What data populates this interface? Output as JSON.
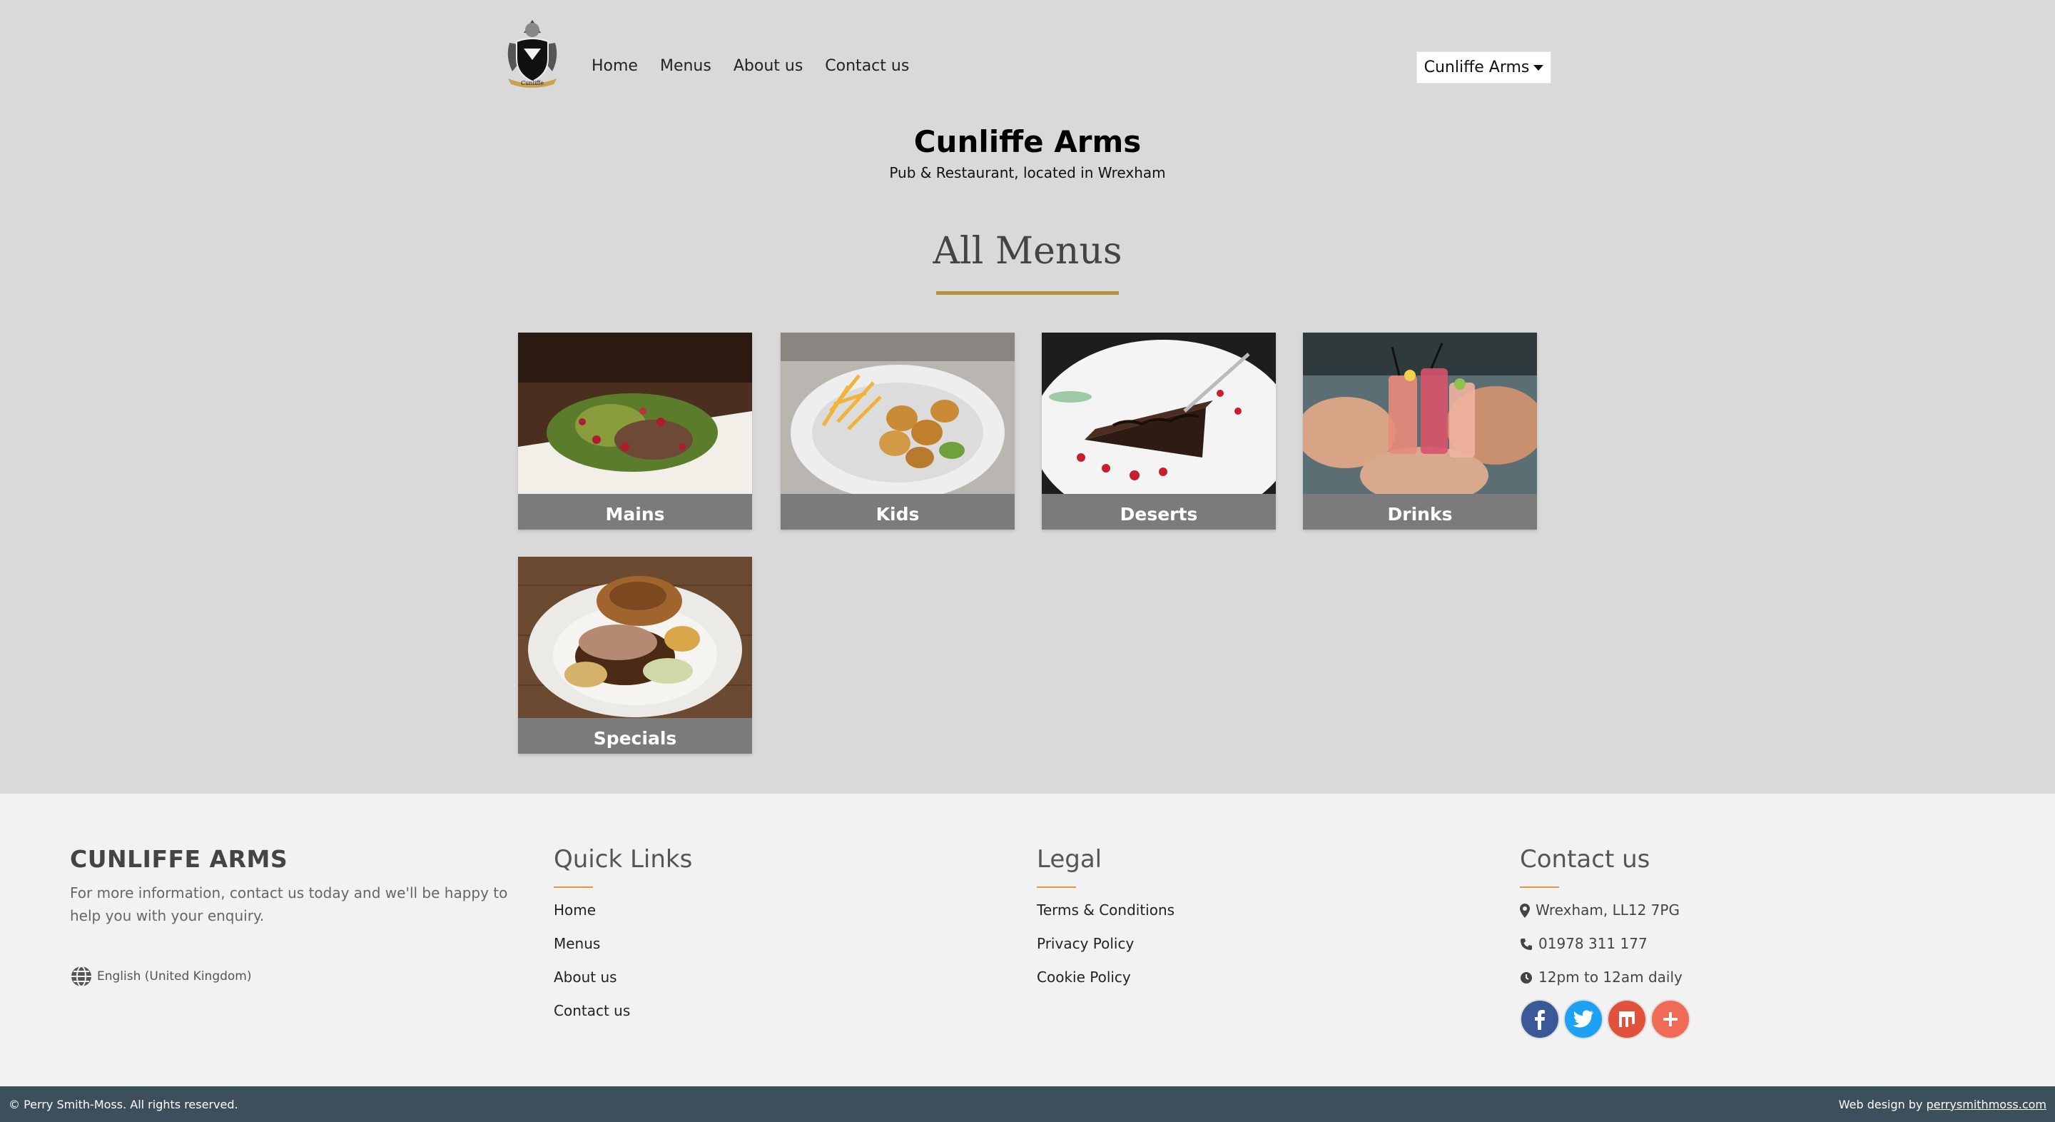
{
  "nav": {
    "links": [
      "Home",
      "Menus",
      "About us",
      "Contact us"
    ],
    "site_selector": "Cunliffe Arms",
    "logo_text": "Cunliffe"
  },
  "brand": {
    "title": "Cunliffe Arms",
    "subtitle": "Pub & Restaurant, located in Wrexham"
  },
  "section": {
    "title": "All Menus",
    "accent": "#b8913a"
  },
  "menus": [
    {
      "label": "Mains"
    },
    {
      "label": "Kids"
    },
    {
      "label": "Deserts"
    },
    {
      "label": "Drinks"
    },
    {
      "label": "Specials"
    }
  ],
  "footer": {
    "brand_heading": "CUNLIFFE ARMS",
    "blurb": "For more information, contact us today and we'll be happy to help you with your enquiry.",
    "language": "English (United Kingdom)",
    "quick_links": {
      "heading": "Quick Links",
      "items": [
        "Home",
        "Menus",
        "About us",
        "Contact us"
      ]
    },
    "legal": {
      "heading": "Legal",
      "items": [
        "Terms & Conditions",
        "Privacy Policy",
        "Cookie Policy"
      ]
    },
    "contact": {
      "heading": "Contact us",
      "address": "Wrexham, LL12 7PG",
      "phone": "01978 311 177",
      "hours": "12pm to 12am daily"
    },
    "socials": [
      {
        "icon": "facebook-icon",
        "color": "#3b5998"
      },
      {
        "icon": "twitter-icon",
        "color": "#1da1f2"
      },
      {
        "icon": "mix-icon",
        "color": "#e0523c"
      },
      {
        "icon": "share-plus-icon",
        "color": "#f06a56"
      }
    ]
  },
  "bottom_bar": {
    "copyright": "© Perry Smith-Moss. All rights reserved.",
    "credit_prefix": "Web design by ",
    "credit_link": "perrysmithmoss.com"
  }
}
